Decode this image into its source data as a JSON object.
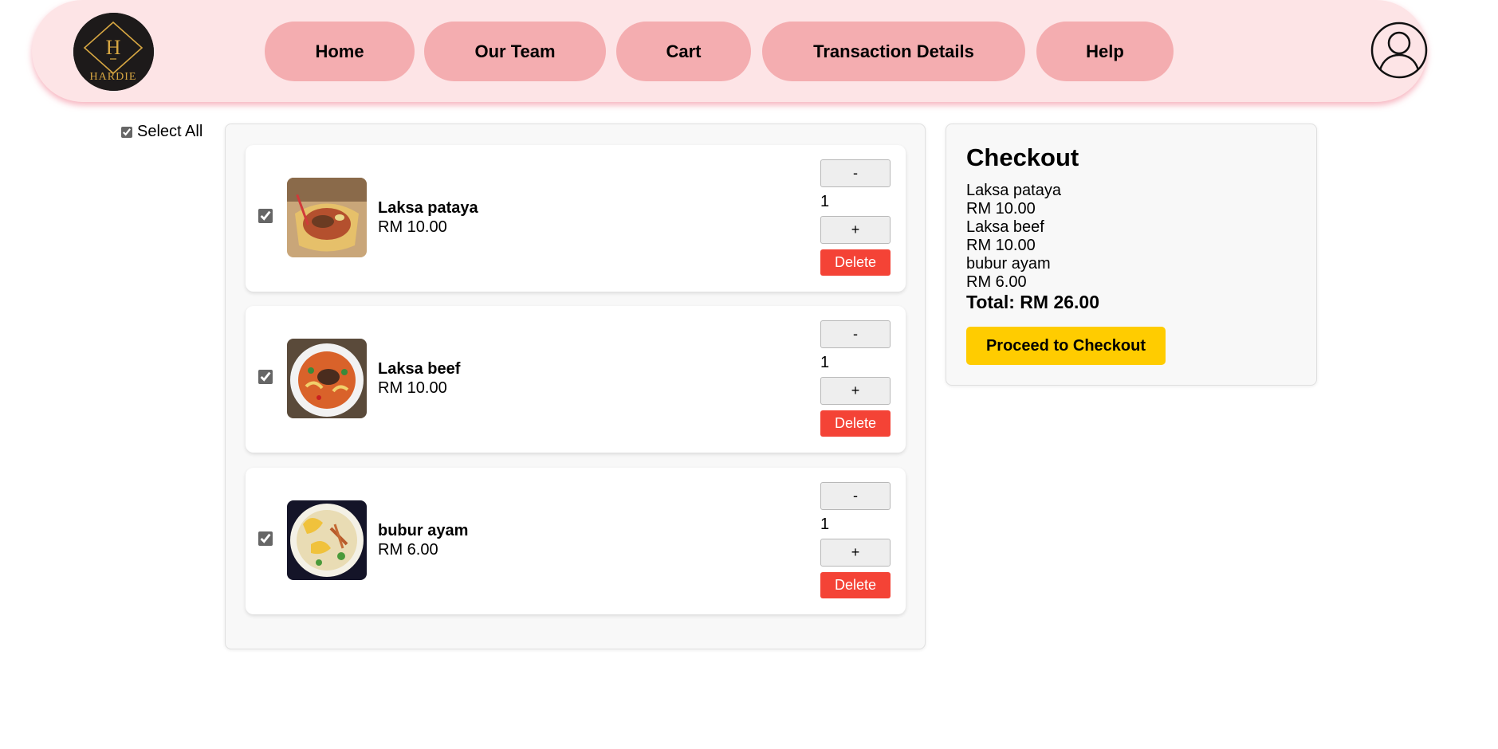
{
  "header": {
    "logo_letter": "H",
    "logo_text": "HARDIE",
    "nav": [
      {
        "label": "Home"
      },
      {
        "label": "Our Team"
      },
      {
        "label": "Cart"
      },
      {
        "label": "Transaction Details"
      },
      {
        "label": "Help"
      }
    ],
    "profile_icon": "user-circle-icon"
  },
  "cart": {
    "select_all_label": "Select All",
    "select_all_checked": true,
    "items": [
      {
        "name": "Laksa pataya",
        "price": "RM 10.00",
        "quantity": "1",
        "checked": true,
        "minus_label": "-",
        "plus_label": "+",
        "delete_label": "Delete"
      },
      {
        "name": "Laksa beef",
        "price": "RM 10.00",
        "quantity": "1",
        "checked": true,
        "minus_label": "-",
        "plus_label": "+",
        "delete_label": "Delete"
      },
      {
        "name": "bubur ayam",
        "price": "RM 6.00",
        "quantity": "1",
        "checked": true,
        "minus_label": "-",
        "plus_label": "+",
        "delete_label": "Delete"
      }
    ]
  },
  "checkout": {
    "title": "Checkout",
    "lines": [
      {
        "name": "Laksa pataya",
        "price": "RM 10.00"
      },
      {
        "name": "Laksa beef",
        "price": "RM 10.00"
      },
      {
        "name": "bubur ayam",
        "price": "RM 6.00"
      }
    ],
    "total": "Total: RM 26.00",
    "button_label": "Proceed to Checkout"
  },
  "colors": {
    "header_bg": "#fde4e6",
    "nav_button": "#f4adb0",
    "delete_button": "#f44336",
    "checkout_button": "#ffcc00"
  }
}
